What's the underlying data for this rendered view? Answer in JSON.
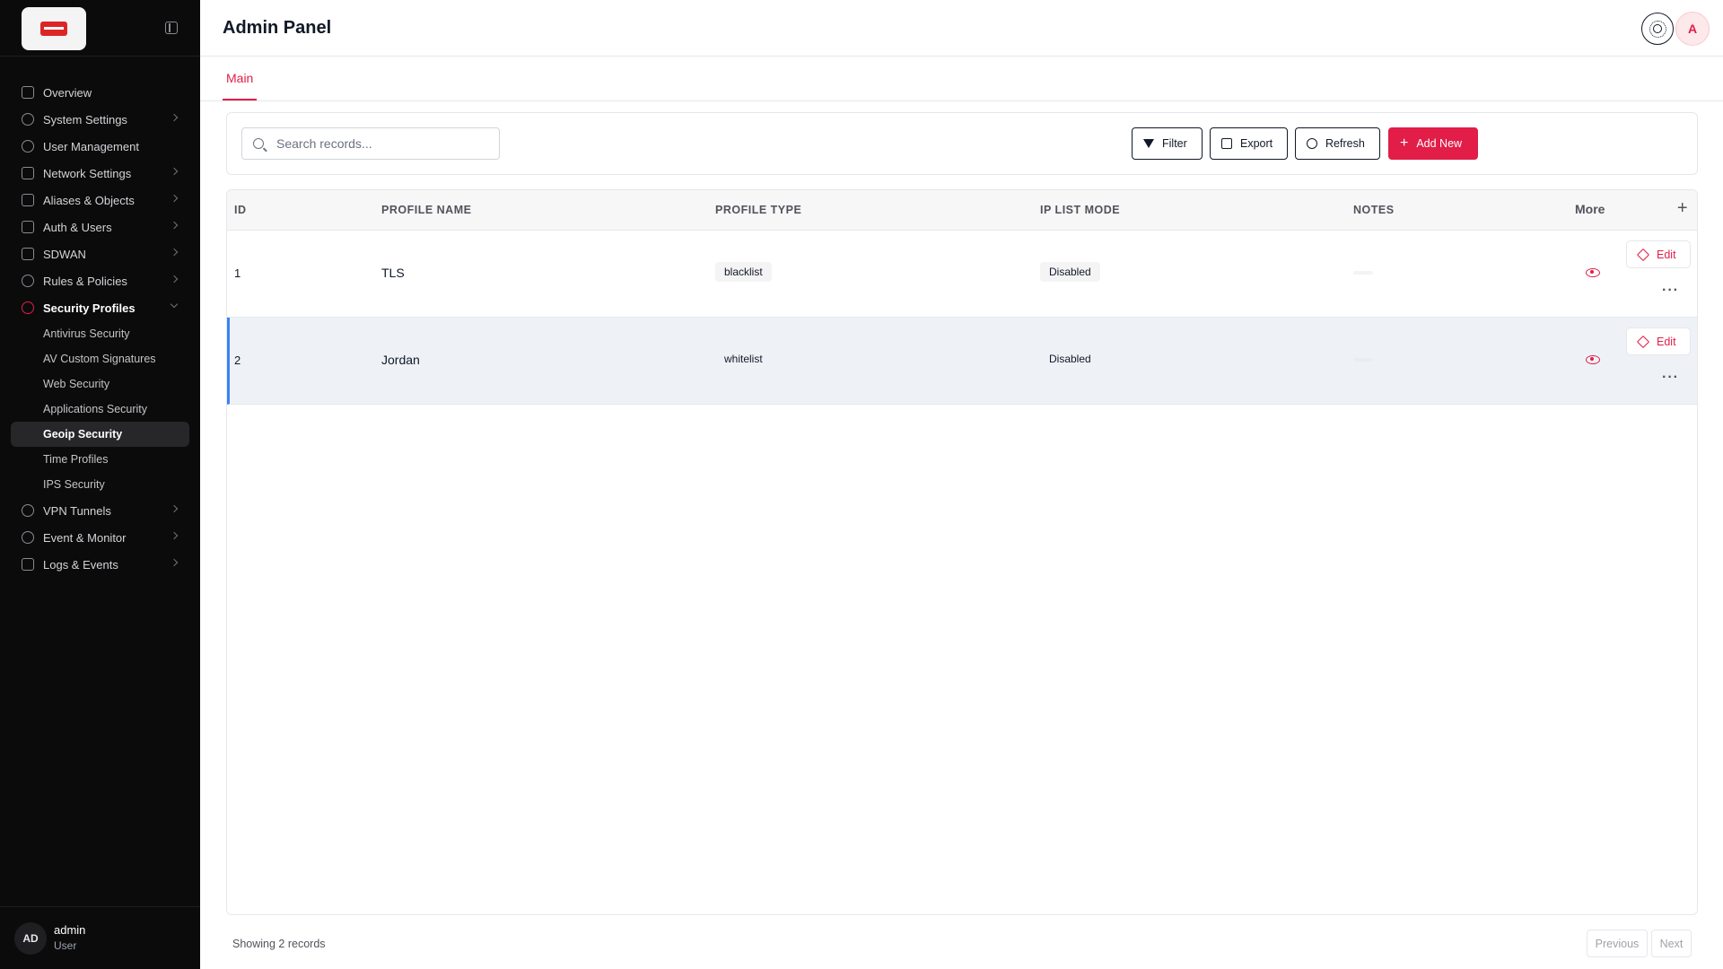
{
  "app": {
    "title": "Admin Panel"
  },
  "header": {
    "avatar_initial": "A"
  },
  "sidebar": {
    "items": [
      {
        "label": "Overview",
        "icon": "grid-icon",
        "has_children": false
      },
      {
        "label": "System Settings",
        "icon": "gear-icon",
        "has_children": true
      },
      {
        "label": "User Management",
        "icon": "user-icon",
        "has_children": false
      },
      {
        "label": "Network Settings",
        "icon": "network-icon",
        "has_children": true
      },
      {
        "label": "Aliases & Objects",
        "icon": "box-icon",
        "has_children": true
      },
      {
        "label": "Auth & Users",
        "icon": "box-icon",
        "has_children": true
      },
      {
        "label": "SDWAN",
        "icon": "box-icon",
        "has_children": true
      },
      {
        "label": "Rules & Policies",
        "icon": "shield-icon",
        "has_children": true
      },
      {
        "label": "Security Profiles",
        "icon": "shield-icon",
        "has_children": true,
        "expanded": true,
        "children": [
          {
            "label": "Antivirus Security"
          },
          {
            "label": "AV Custom Signatures"
          },
          {
            "label": "Web Security"
          },
          {
            "label": "Applications Security"
          },
          {
            "label": "Geoip Security",
            "selected": true
          },
          {
            "label": "Time Profiles"
          },
          {
            "label": "IPS Security"
          }
        ]
      },
      {
        "label": "VPN Tunnels",
        "icon": "shield-check-icon",
        "has_children": true
      },
      {
        "label": "Event & Monitor",
        "icon": "shield-check-icon",
        "has_children": true
      },
      {
        "label": "Logs & Events",
        "icon": "file-icon",
        "has_children": true
      }
    ],
    "user": {
      "initials": "AD",
      "name": "admin",
      "role": "User"
    }
  },
  "tabs": [
    {
      "label": "Main",
      "active": true
    }
  ],
  "toolbar": {
    "search_placeholder": "Search records...",
    "filter_label": "Filter",
    "export_label": "Export",
    "refresh_label": "Refresh",
    "add_label": "Add New"
  },
  "table": {
    "columns": [
      "ID",
      "PROFILE NAME",
      "PROFILE TYPE",
      "IP LIST MODE",
      "NOTES",
      "More"
    ],
    "rows": [
      {
        "id": "1",
        "profile_name": "TLS",
        "profile_type": "blacklist",
        "ip_list_mode": "Disabled",
        "notes": "",
        "edit_label": "Edit"
      },
      {
        "id": "2",
        "profile_name": "Jordan",
        "profile_type": "whitelist",
        "ip_list_mode": "Disabled",
        "notes": "",
        "edit_label": "Edit",
        "highlighted": true
      }
    ]
  },
  "footer": {
    "info": "Showing 2 records",
    "prev_label": "Previous",
    "next_label": "Next"
  },
  "colors": {
    "accent": "#e11d48",
    "sidebar_bg": "#0b0b0c",
    "row_highlight": "#eef2f7",
    "row_highlight_border": "#3b82f6"
  }
}
